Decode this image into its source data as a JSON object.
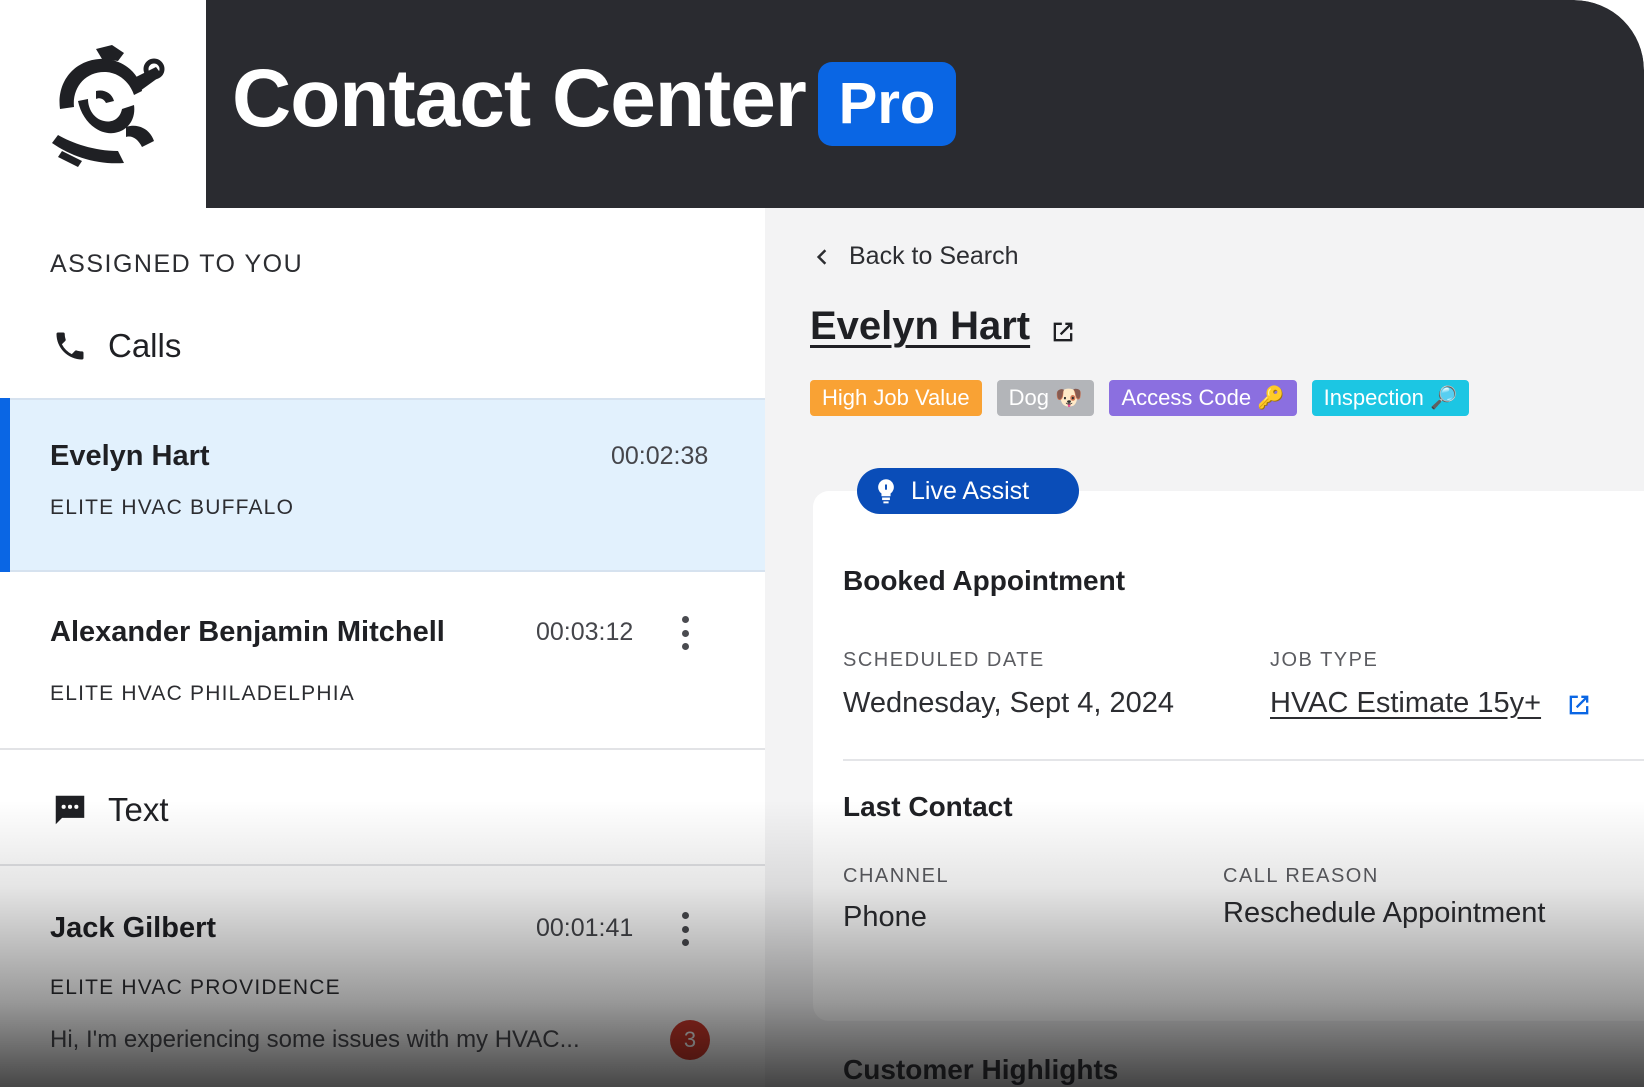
{
  "header": {
    "title": "Contact Center",
    "badge": "Pro",
    "logo_icon": "warrior-mascot-icon"
  },
  "left_panel": {
    "assigned_label": "ASSIGNED TO YOU",
    "calls_section": {
      "label": "Calls",
      "icon": "phone-icon"
    },
    "calls": [
      {
        "name": "Evelyn Hart",
        "company": "ELITE HVAC BUFFALO",
        "duration": "00:02:38",
        "active": true
      },
      {
        "name": "Alexander Benjamin Mitchell",
        "company": "ELITE HVAC PHILADELPHIA",
        "duration": "00:03:12",
        "active": false
      }
    ],
    "text_section": {
      "label": "Text",
      "icon": "chat-bubble-icon"
    },
    "texts": [
      {
        "name": "Jack Gilbert",
        "company": "ELITE HVAC PROVIDENCE",
        "duration": "00:01:41",
        "preview": "Hi, I'm experiencing some issues with my HVAC...",
        "unread": "3"
      }
    ]
  },
  "detail": {
    "back_label": "Back to Search",
    "customer_name": "Evelyn Hart",
    "tags": [
      {
        "label": "High Job Value",
        "color": "#f9a234"
      },
      {
        "label": "Dog 🐶",
        "color": "#b3b5b9"
      },
      {
        "label": "Access Code 🔑",
        "color": "#8b6fe0"
      },
      {
        "label": "Inspection 🔎",
        "color": "#1cc6e3"
      }
    ],
    "live_assist_label": "Live Assist",
    "booked": {
      "title": "Booked Appointment",
      "scheduled_label": "SCHEDULED DATE",
      "scheduled_value": "Wednesday, Sept 4, 2024",
      "job_type_label": "JOB TYPE",
      "job_type_value": "HVAC Estimate  15y+"
    },
    "last_contact": {
      "title": "Last Contact",
      "channel_label": "CHANNEL",
      "channel_value": "Phone",
      "reason_label": "CALL REASON",
      "reason_value": "Reschedule Appointment"
    },
    "next_section_title": "Customer Highlights"
  },
  "colors": {
    "header_bg": "#2a2b30",
    "brand_blue": "#0a66e4",
    "live_assist_blue": "#0a4db8",
    "active_row_bg": "#e2f1fd",
    "unread_red": "#d33a2c"
  }
}
